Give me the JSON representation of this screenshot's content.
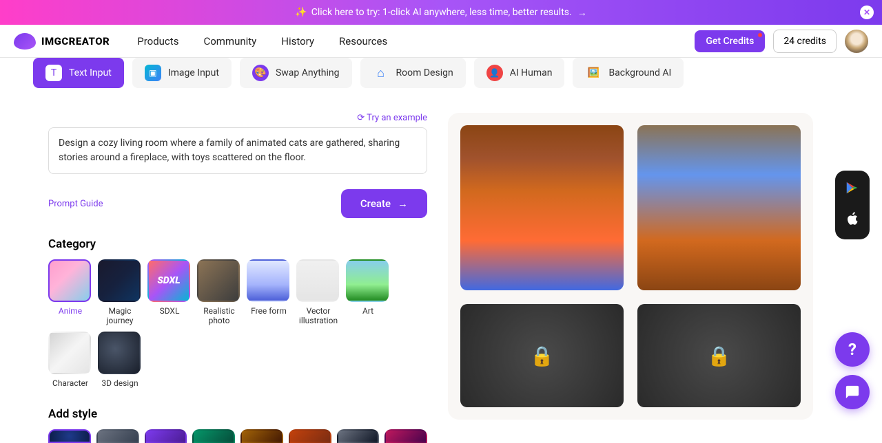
{
  "banner": {
    "text": "Click here to try: 1-click AI anywhere, less time, better results."
  },
  "header": {
    "logo": "IMGCREATOR",
    "nav": [
      "Products",
      "Community",
      "History",
      "Resources"
    ],
    "get_credits": "Get Credits",
    "credits_count": "24 credits"
  },
  "tabs": [
    {
      "label": "Text Input"
    },
    {
      "label": "Image Input"
    },
    {
      "label": "Swap Anything"
    },
    {
      "label": "Room Design"
    },
    {
      "label": "AI Human"
    },
    {
      "label": "Background AI"
    }
  ],
  "example_link": "Try an example",
  "prompt_value": "Design a cozy living room where a family of animated cats are gathered, sharing stories around a fireplace, with toys scattered on the floor.",
  "prompt_guide": "Prompt Guide",
  "create_btn": "Create",
  "category_title": "Category",
  "categories": [
    {
      "label": "Anime"
    },
    {
      "label": "Magic journey"
    },
    {
      "label": "SDXL"
    },
    {
      "label": "Realistic photo"
    },
    {
      "label": "Free form"
    },
    {
      "label": "Vector illustration"
    },
    {
      "label": "Art"
    },
    {
      "label": "Character"
    },
    {
      "label": "3D design"
    }
  ],
  "style_title": "Add style",
  "help_label": "?"
}
